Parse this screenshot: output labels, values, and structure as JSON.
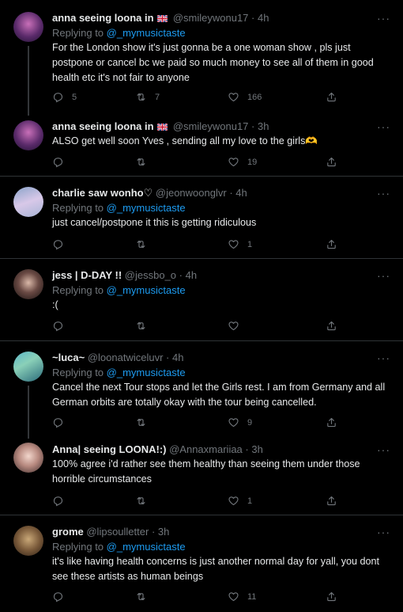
{
  "tweets": [
    {
      "name": "anna seeing loona in",
      "flag": "uk-flag",
      "handle": "@smileywonu17",
      "time": "· 4h",
      "replying_prefix": "Replying to",
      "replying_to": "@_mymusictaste",
      "text": "For the London show it's just gonna be a one woman show , pls just postpone or cancel bc we paid so much money to see all of them in good health etc it's not fair to anyone",
      "replies": "5",
      "retweets": "7",
      "likes": "166"
    },
    {
      "name": "anna seeing loona in",
      "flag": "uk-flag",
      "handle": "@smileywonu17",
      "time": "· 3h",
      "text": "ALSO get well soon Yves , sending all my love to the girls🫶",
      "replies": "",
      "retweets": "",
      "likes": "19"
    },
    {
      "name": "charlie saw wonho♡",
      "handle": "@jeonwoonglvr",
      "time": "· 4h",
      "replying_prefix": "Replying to",
      "replying_to": "@_mymusictaste",
      "text": "just cancel/postpone it this is getting ridiculous",
      "replies": "",
      "retweets": "",
      "likes": "1"
    },
    {
      "name": "jess | D-DAY !!",
      "handle": "@jessbo_o",
      "time": "· 4h",
      "replying_prefix": "Replying to",
      "replying_to": "@_mymusictaste",
      "text": ":(",
      "replies": "",
      "retweets": "",
      "likes": ""
    },
    {
      "name": "~luca~",
      "handle": "@loonatwiceluvr",
      "time": "· 4h",
      "replying_prefix": "Replying to",
      "replying_to": "@_mymusictaste",
      "text": "Cancel the next Tour stops and let the Girls rest. I am from Germany and all German orbits are totally okay with the tour being cancelled.",
      "replies": "",
      "retweets": "",
      "likes": "9"
    },
    {
      "name": "Anna| seeing LOONA!:)",
      "handle": "@Annaxmariiaa",
      "time": "· 3h",
      "text": "100% agree i'd rather see them healthy than seeing them under those horrible circumstances",
      "replies": "",
      "retweets": "",
      "likes": "1"
    },
    {
      "name": "grome",
      "handle": "@lipsoulletter",
      "time": "· 3h",
      "replying_prefix": "Replying to",
      "replying_to": "@_mymusictaste",
      "text": "it's like having health concerns is just another normal day for yall, you dont see these artists as human beings",
      "replies": "",
      "retweets": "",
      "likes": "11"
    }
  ],
  "more_label": "···",
  "colors": {
    "background": "#000000",
    "text": "#e7e9ea",
    "muted": "#71767b",
    "link": "#1d9bf0",
    "divider": "#2f3336"
  },
  "icons": [
    "reply-icon",
    "retweet-icon",
    "like-icon",
    "share-icon",
    "more-icon",
    "uk-flag"
  ]
}
